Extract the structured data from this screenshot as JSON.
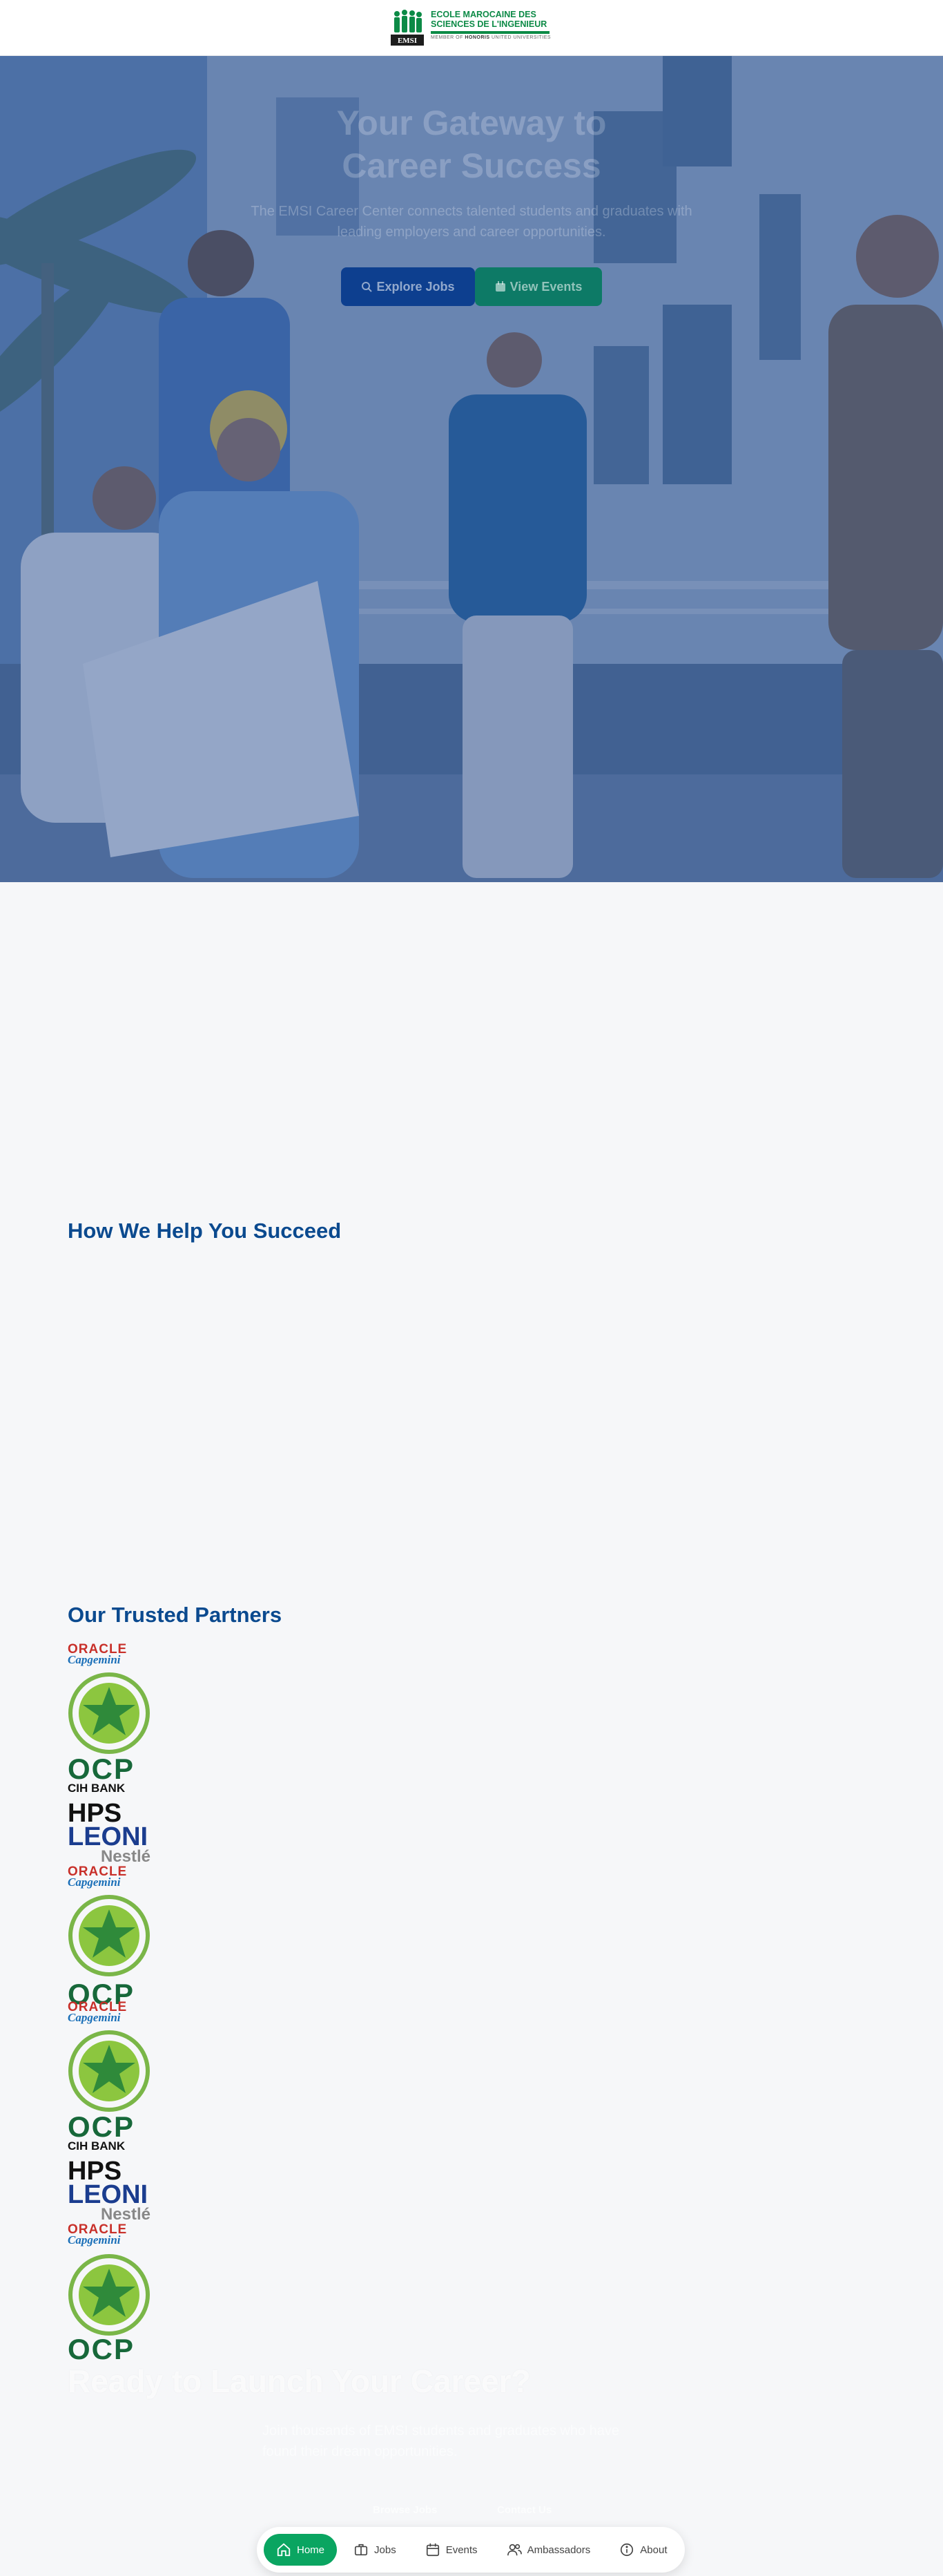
{
  "header": {
    "logo_line1": "ECOLE MAROCAINE DES",
    "logo_line2": "SCIENCES DE L'INGENIEUR",
    "logo_sub_prefix": "MEMBER OF",
    "logo_sub_bold": "HONORIS",
    "logo_sub_suffix": "UNITED UNIVERSITIES",
    "logo_badge": "EMSI"
  },
  "hero": {
    "title_line1": "Your Gateway to",
    "title_line2": "Career Success",
    "subtitle": "The EMSI Career Center connects talented students and graduates with leading employers and career opportunities.",
    "primary_button": "Explore Jobs",
    "secondary_button": "View Events"
  },
  "sections": {
    "help_title": "How We Help You Succeed",
    "partners_title": "Our Trusted Partners"
  },
  "partners": [
    {
      "name": "ORACLE"
    },
    {
      "name": "Capgemini"
    },
    {
      "name": "star-emblem"
    },
    {
      "name": "OCP"
    },
    {
      "name": "CIH BANK"
    },
    {
      "name": "HPS"
    },
    {
      "name": "LEONI"
    },
    {
      "name": "Nestlé"
    }
  ],
  "cta": {
    "title": "Ready to Launch Your Career?",
    "subtitle": "Join thousands of EMSI students and graduates who have found their dream opportunities.",
    "button1": "Browse Jobs",
    "button2": "Contact Us"
  },
  "nav": {
    "items": [
      {
        "label": "Home",
        "icon": "home-icon",
        "active": true
      },
      {
        "label": "Jobs",
        "icon": "briefcase-icon",
        "active": false
      },
      {
        "label": "Events",
        "icon": "calendar-icon",
        "active": false
      },
      {
        "label": "Ambassadors",
        "icon": "users-icon",
        "active": false
      },
      {
        "label": "About",
        "icon": "info-icon",
        "active": false
      }
    ]
  },
  "colors": {
    "accent_green": "#0aa561",
    "brand_blue": "#0b4a8f",
    "logo_green": "#0c8a46"
  }
}
